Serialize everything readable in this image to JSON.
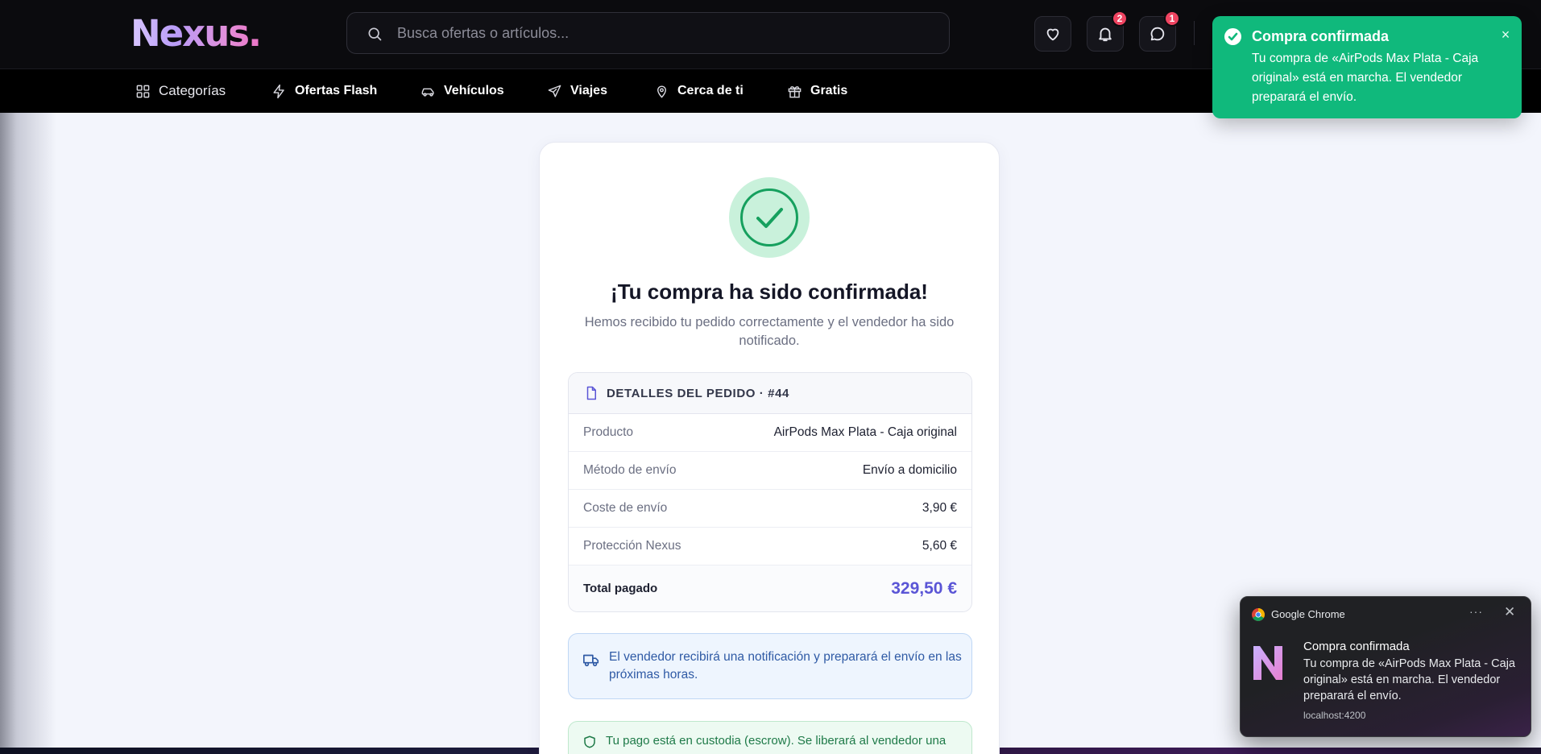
{
  "brand": {
    "logo_text": "Nexus."
  },
  "search": {
    "placeholder": "Busca ofertas o artículos..."
  },
  "header_actions": [
    {
      "name": "favorites",
      "icon": "heart-icon",
      "badge": ""
    },
    {
      "name": "notifications",
      "icon": "bell-icon",
      "badge": "2"
    },
    {
      "name": "messages",
      "icon": "chat-bubble-icon",
      "badge": "1"
    }
  ],
  "nav": {
    "items": [
      {
        "label": "Categorías",
        "icon": "grid-icon"
      },
      {
        "label": "Ofertas Flash",
        "icon": "lightning-icon"
      },
      {
        "label": "Vehículos",
        "icon": "car-icon"
      },
      {
        "label": "Viajes",
        "icon": "plane-icon"
      },
      {
        "label": "Cerca de ti",
        "icon": "map-pin-icon"
      },
      {
        "label": "Gratis",
        "icon": "gift-icon"
      }
    ]
  },
  "confirmation": {
    "title": "¡Tu compra ha sido confirmada!",
    "subtitle": "Hemos recibido tu pedido correctamente y el vendedor ha sido notificado.",
    "details_header": "DETALLES DEL PEDIDO · #44",
    "rows": [
      {
        "label": "Producto",
        "value": "AirPods Max Plata - Caja original"
      },
      {
        "label": "Método de envío",
        "value": "Envío a domicilio"
      },
      {
        "label": "Coste de envío",
        "value": "3,90 €"
      },
      {
        "label": "Protección Nexus",
        "value": "5,60 €"
      }
    ],
    "total": {
      "label": "Total pagado",
      "value": "329,50 €"
    },
    "shipping_info": "El vendedor recibirá una notificación y preparará el envío en las próximas horas.",
    "escrow_info": "Tu pago está en custodia (escrow). Se liberará al vendedor una"
  },
  "toast": {
    "title": "Compra confirmada",
    "message": "Tu compra de «AirPods Max Plata - Caja original» está en marcha. El vendedor preparará el envío.",
    "close": "×",
    "color": "#10b97c"
  },
  "chrome_notification": {
    "app": "Google Chrome",
    "more": "···",
    "close": "✕",
    "title": "Compra confirmada",
    "message": "Tu compra de «AirPods Max Plata - Caja original» está en marcha. El vendedor preparará el envío.",
    "source": "localhost:4200"
  },
  "colors": {
    "accent": "#5a55d6",
    "success": "#16a05e",
    "header_bg": "#0b0b0e"
  }
}
